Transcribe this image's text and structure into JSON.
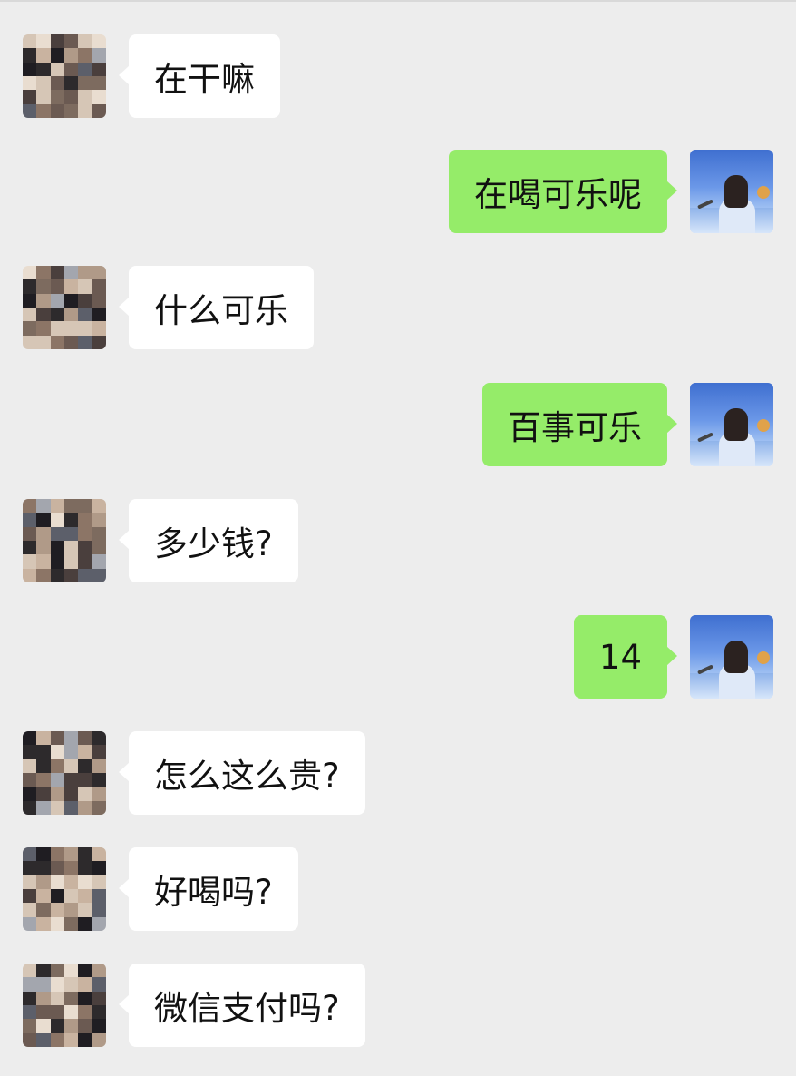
{
  "chat": {
    "messages": [
      {
        "side": "left",
        "text": "在干嘛"
      },
      {
        "side": "right",
        "text": "在喝可乐呢"
      },
      {
        "side": "left",
        "text": "什么可乐"
      },
      {
        "side": "right",
        "text": "百事可乐"
      },
      {
        "side": "left",
        "text": "多少钱?"
      },
      {
        "side": "right",
        "text": "14"
      },
      {
        "side": "left",
        "text": "怎么这么贵?"
      },
      {
        "side": "left",
        "text": "好喝吗?"
      },
      {
        "side": "left",
        "text": "微信支付吗?"
      }
    ]
  },
  "colors": {
    "background": "#ededed",
    "incoming_bubble": "#ffffff",
    "outgoing_bubble": "#95ec69",
    "text": "#111111"
  },
  "icons": {
    "contact_avatar": "pixelated-avatar",
    "self_avatar": "girl-by-sea-avatar"
  }
}
